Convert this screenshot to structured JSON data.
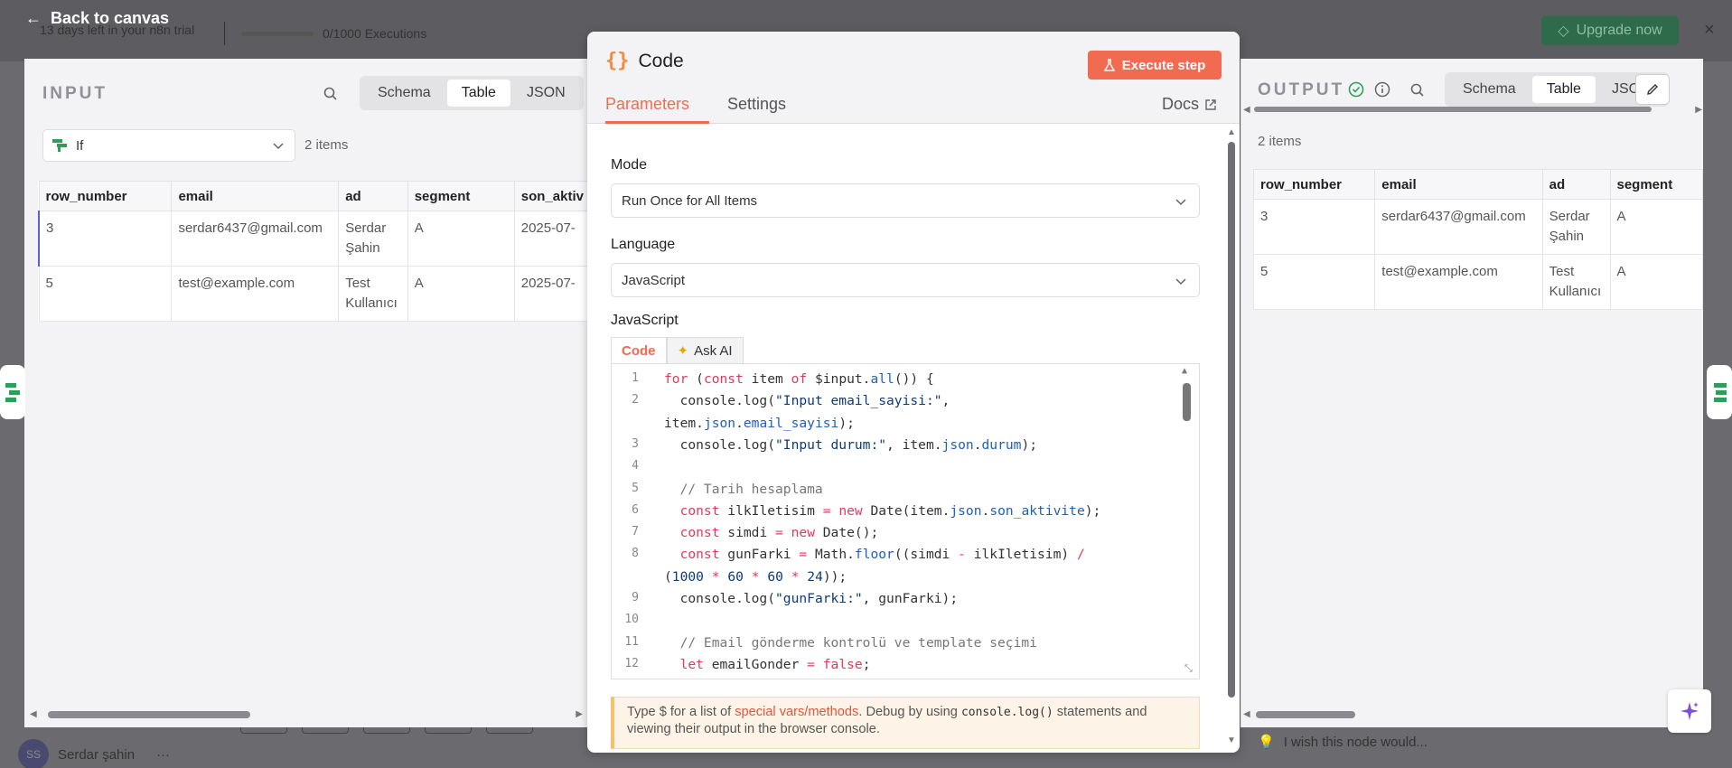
{
  "background": {
    "trial_text": "13 days left in your n8n trial",
    "executions": "0/1000 Executions",
    "upgrade_label": "Upgrade now",
    "user_initials": "SS",
    "user_name": "Serdar şahin"
  },
  "back_label": "Back to canvas",
  "input_panel": {
    "title": "INPUT",
    "view_tabs": [
      "Schema",
      "Table",
      "JSON"
    ],
    "active_tab": "Table",
    "node": "If",
    "items_count": "2 items",
    "columns": [
      "row_number",
      "email",
      "ad",
      "segment",
      "son_aktiv"
    ],
    "rows": [
      [
        "3",
        "serdar6437@gmail.com",
        "Serdar\nŞahin",
        "A",
        "2025-07-"
      ],
      [
        "5",
        "test@example.com",
        "Test\nKullanıcı",
        "A",
        "2025-07-"
      ]
    ]
  },
  "code_node": {
    "title": "Code",
    "execute_label": "Execute step",
    "tabs": [
      "Parameters",
      "Settings"
    ],
    "active_tab": "Parameters",
    "docs_label": "Docs",
    "mode_label": "Mode",
    "mode_value": "Run Once for All Items",
    "language_label": "Language",
    "language_value": "JavaScript",
    "code_label": "JavaScript",
    "code_tabs": [
      "Code",
      "Ask AI"
    ],
    "active_code_tab": "Code",
    "code_lines": [
      {
        "n": "1",
        "text": "for (const item of $input.all()) {"
      },
      {
        "n": "2",
        "text": "  console.log(\"Input email_sayisi:\","
      },
      {
        "n": "",
        "text": "item.json.email_sayisi);"
      },
      {
        "n": "3",
        "text": "  console.log(\"Input durum:\", item.json.durum);"
      },
      {
        "n": "4",
        "text": ""
      },
      {
        "n": "5",
        "text": "  // Tarih hesaplama"
      },
      {
        "n": "6",
        "text": "  const ilkIletisim = new Date(item.json.son_aktivite);"
      },
      {
        "n": "7",
        "text": "  const simdi = new Date();"
      },
      {
        "n": "8",
        "text": "  const gunFarki = Math.floor((simdi - ilkIletisim) /"
      },
      {
        "n": "",
        "text": "(1000 * 60 * 60 * 24));"
      },
      {
        "n": "9",
        "text": "  console.log(\"gunFarki:\", gunFarki);"
      },
      {
        "n": "10",
        "text": ""
      },
      {
        "n": "11",
        "text": "  // Email gönderme kontrolü ve template seçimi"
      },
      {
        "n": "12",
        "text": "  let emailGonder = false;"
      }
    ],
    "hint": {
      "before": "Type $ for a list of ",
      "link": "special vars/methods",
      "middle": ". Debug by using ",
      "code": "console.log()",
      "after": " statements and viewing their output in the browser console."
    }
  },
  "output_panel": {
    "title": "OUTPUT",
    "view_tabs": [
      "Schema",
      "Table",
      "JSON"
    ],
    "active_tab": "Table",
    "items_count": "2 items",
    "columns": [
      "row_number",
      "email",
      "ad",
      "segment"
    ],
    "rows": [
      [
        "3",
        "serdar6437@gmail.com",
        "Serdar\nŞahin",
        "A"
      ],
      [
        "5",
        "test@example.com",
        "Test\nKullanıcı",
        "A"
      ]
    ]
  },
  "feedback_text": "I wish this node would...",
  "colors": {
    "accent": "#f06b50",
    "upgrade": "#2d6b4a",
    "success": "#2e9e5b"
  }
}
